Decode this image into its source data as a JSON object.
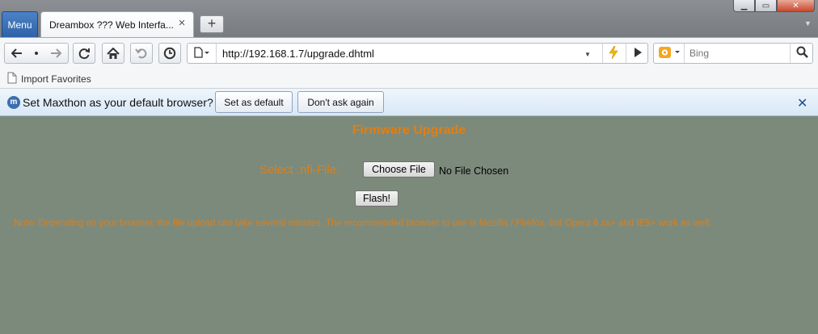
{
  "browser": {
    "menu_label": "Menu",
    "tab": {
      "title": "Dreambox ??? Web Interfa..."
    },
    "new_tab_label": "+",
    "address": {
      "url": "http://192.168.1.7/upgrade.dhtml"
    },
    "search": {
      "engine": "Bing",
      "placeholder": "Bing"
    },
    "favorites": [
      {
        "label": "Import Favorites"
      }
    ],
    "notification": {
      "text": "Set Maxthon as your default browser?",
      "set_default_label": "Set as default",
      "dont_ask_label": "Don't ask again",
      "icon_letter": "m"
    }
  },
  "page": {
    "title": "Firmware Upgrade",
    "select_label": "Select .nfi-File:",
    "choose_file_label": "Choose File",
    "file_status": "No File Chosen",
    "flash_label": "Flash!",
    "note": "Note: Depending on your browser, the file upload can take several minutes. The recommended browser to use is Mozilla / Firefox, but Opera 6.xx+ and IE5+ work as well."
  },
  "colors": {
    "page_background": "#7c8a7b",
    "accent_text": "#e07f14",
    "menu_button": "#3a6fb5"
  },
  "icons": [
    "back-icon",
    "dot-icon",
    "forward-icon",
    "refresh-icon",
    "home-icon",
    "undo-icon",
    "history-icon",
    "page-icon",
    "bolt-icon",
    "play-icon",
    "bing-icon",
    "search-icon",
    "close-icon",
    "maxthon-icon"
  ]
}
